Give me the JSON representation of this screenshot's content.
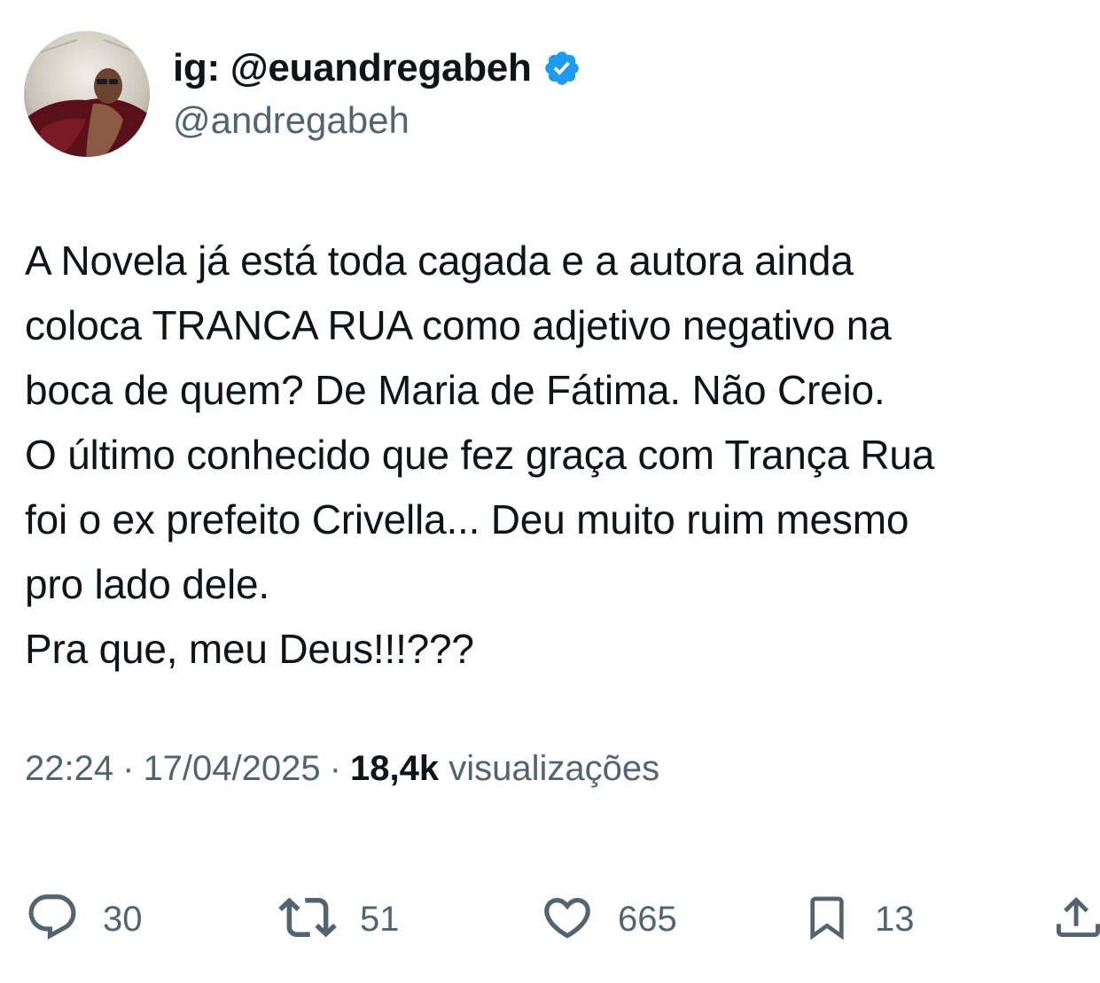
{
  "author": {
    "display_name": "ig: @euandregabeh",
    "handle": "@andregabeh",
    "verified": true,
    "verified_color": "#1d9bf0"
  },
  "tweet": {
    "lines": [
      "A Novela já está toda cagada e a autora ainda",
      "coloca TRANCA RUA como adjetivo negativo na",
      "boca de quem? De Maria de Fátima. Não Creio.",
      "O último conhecido que fez graça com Trança Rua",
      "foi o ex prefeito Crivella... Deu muito ruim mesmo",
      "pro lado dele.",
      "Pra que, meu Deus!!!???"
    ]
  },
  "meta": {
    "time": "22:24",
    "separator": "·",
    "date": "17/04/2025",
    "views_count": "18,4k",
    "views_label": "visualizações"
  },
  "actions": {
    "replies": "30",
    "reposts": "51",
    "likes": "665",
    "bookmarks": "13"
  },
  "icons": {
    "reply": "reply-icon",
    "repost": "repost-icon",
    "like": "heart-icon",
    "bookmark": "bookmark-icon",
    "share": "share-icon",
    "verified": "verified-badge-icon"
  },
  "colors": {
    "text_primary": "#0f1419",
    "text_secondary": "#536471",
    "accent": "#1d9bf0"
  }
}
